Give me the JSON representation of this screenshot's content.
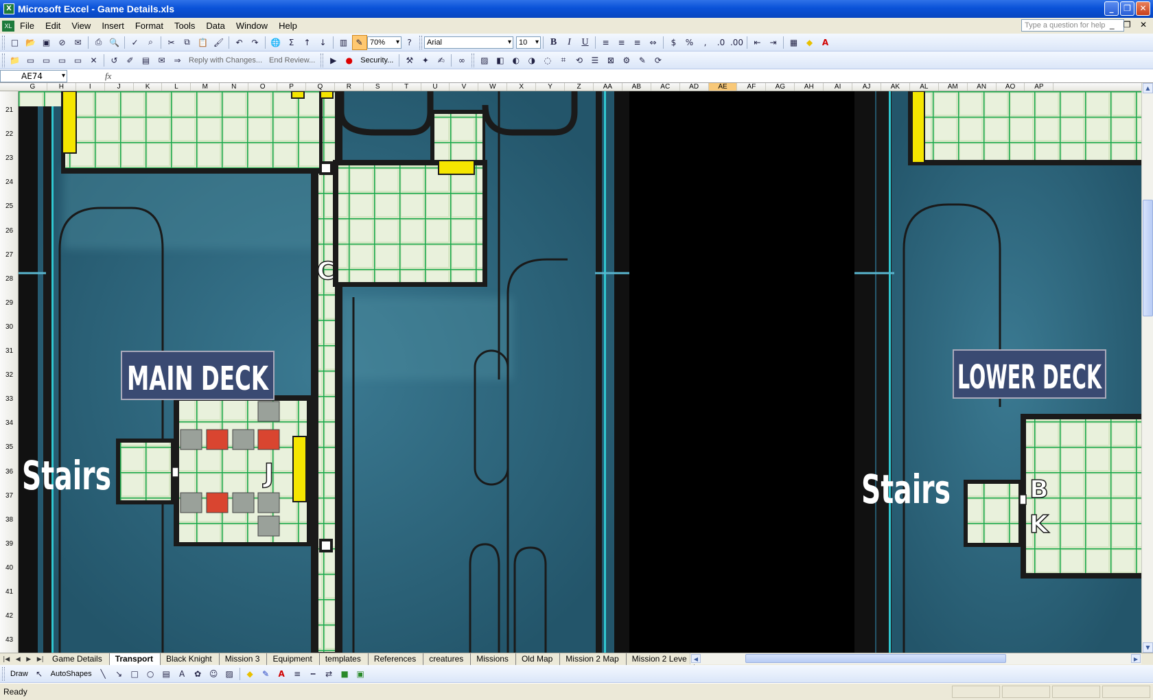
{
  "window": {
    "title": "Microsoft Excel - Game Details.xls",
    "app_icon": "X"
  },
  "menu": {
    "items": [
      "File",
      "Edit",
      "View",
      "Insert",
      "Format",
      "Tools",
      "Data",
      "Window",
      "Help"
    ],
    "ask_placeholder": "Type a question for help"
  },
  "toolbar": {
    "zoom": "70%",
    "font": "Arial",
    "size": "10",
    "reply_label": "Reply with Changes...",
    "end_review_label": "End Review...",
    "security_label": "Security..."
  },
  "formula": {
    "namebox": "AE74",
    "fx": "fx",
    "content": ""
  },
  "columns": [
    "G",
    "H",
    "I",
    "J",
    "K",
    "L",
    "M",
    "N",
    "O",
    "P",
    "Q",
    "R",
    "S",
    "T",
    "U",
    "V",
    "W",
    "X",
    "Y",
    "Z",
    "AA",
    "AB",
    "AC",
    "AD",
    "AE",
    "AF",
    "AG",
    "AH",
    "AI",
    "AJ",
    "AK",
    "AL",
    "AM",
    "AN",
    "AO",
    "AP"
  ],
  "selected_column": "AE",
  "rows": [
    "21",
    "22",
    "23",
    "24",
    "25",
    "26",
    "27",
    "28",
    "29",
    "30",
    "31",
    "32",
    "33",
    "34",
    "35",
    "36",
    "37",
    "38",
    "39",
    "40",
    "41",
    "42",
    "43"
  ],
  "map": {
    "main_deck": "MAIN DECK",
    "lower_deck": "LOWER DECK",
    "stairs_left": "Stairs",
    "stairs_right": "Stairs",
    "label_c": "C",
    "label_j": "J",
    "label_b": "B",
    "label_k": "K"
  },
  "sheets": [
    "Game Details",
    "Transport",
    "Black Knight",
    "Mission 3",
    "Equipment",
    "templates",
    "References",
    "creatures",
    "Missions",
    "Old Map",
    "Mission 2 Map",
    "Mission 2 Leve"
  ],
  "active_sheet": "Transport",
  "draw": {
    "draw_label": "Draw",
    "autoshapes_label": "AutoShapes"
  },
  "status": {
    "text": "Ready"
  },
  "colors": {
    "water": "#2c6175",
    "wall": "#1a1a1a",
    "floor": "#d8e8c8",
    "grid_line": "#16a84a",
    "door": "#f5e600",
    "crate_red": "#d94530",
    "crate_gray": "#9aa19a",
    "label_bg": "#3a4a72"
  }
}
